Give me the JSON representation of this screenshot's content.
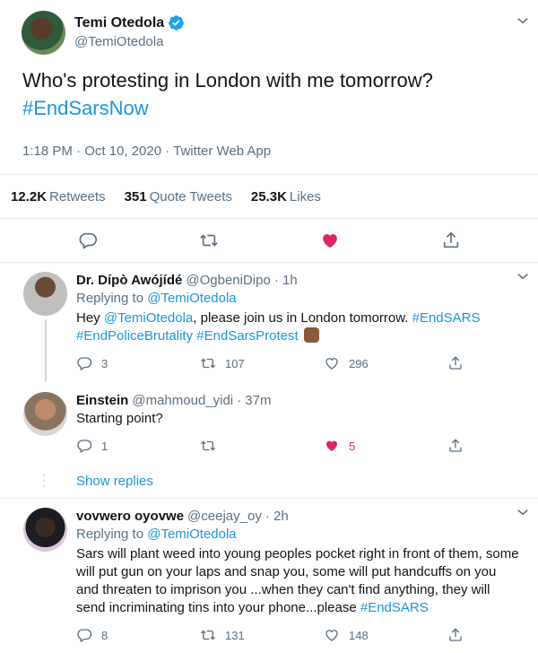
{
  "main_tweet": {
    "author_name": "Temi Otedola",
    "author_handle": "@TemiOtedola",
    "text": "Who's protesting in London with me tomorrow?",
    "hashtag": "#EndSarsNow",
    "meta": "1:18 PM · Oct 10, 2020 · Twitter Web App",
    "stats": [
      {
        "count": "12.2K",
        "label": "Retweets"
      },
      {
        "count": "351",
        "label": "Quote Tweets"
      },
      {
        "count": "25.3K",
        "label": "Likes"
      }
    ]
  },
  "replies": [
    {
      "name": "Dr. Dípò Awójídé",
      "handle": "@OgbeniDipo",
      "time": "· 1h",
      "replying_prefix": "Replying to",
      "replying_to": "@TemiOtedola",
      "text_parts": {
        "a": "Hey ",
        "mention": "@TemiOtedola",
        "b": ", please join us in London tomorrow. ",
        "tag1": "#EndSARS",
        "tag2": "#EndPoliceBrutality",
        "tag3": "#EndSarsProtest"
      },
      "reply_count": "3",
      "retweet_count": "107",
      "like_count": "296"
    },
    {
      "name": "Einstein",
      "handle": "@mahmoud_yidi",
      "time": "· 37m",
      "text": "Starting point?",
      "reply_count": "1",
      "retweet_count": "",
      "like_count": "5"
    },
    {
      "name": "vovwero oyovwe",
      "handle": "@ceejay_oy",
      "time": "· 2h",
      "replying_prefix": "Replying to",
      "replying_to": "@TemiOtedola",
      "text": "Sars will plant weed into young peoples pocket right in front of them, some will put gun on your laps and snap you, some will put  handcuffs on you and threaten to imprison you ...when they can't find anything, they will send incriminating tins into your phone...please ",
      "tag": "#EndSARS",
      "reply_count": "8",
      "retweet_count": "131",
      "like_count": "148"
    }
  ],
  "show_replies_label": "Show replies",
  "colors": {
    "accent": "#1b95e0",
    "like_active": "#e0245e",
    "muted": "#5b7083",
    "divider": "#e6ecf0"
  },
  "icons": [
    "verified-badge-icon",
    "caret-down-icon",
    "reply-icon",
    "retweet-icon",
    "like-icon",
    "share-icon",
    "raised-fist-emoji"
  ]
}
